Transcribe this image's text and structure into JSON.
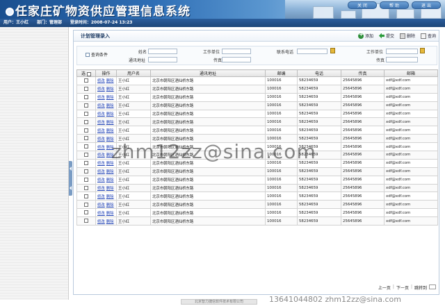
{
  "app": {
    "title": "任家庄矿物资供应管理信息系统"
  },
  "top_buttons": [
    "关 闭",
    "帮 助",
    "退 出"
  ],
  "userbar": {
    "user": "用户：王小红",
    "dept": "部门：管理部",
    "login": "登录时间：2008-07-24 13:23"
  },
  "panel": {
    "title": "计划管理录入",
    "toolbar": {
      "add": "添加",
      "submit": "提交",
      "delete": "删除",
      "query": "查询"
    }
  },
  "query": {
    "condition": "查询条件",
    "name": "姓名",
    "work_unit": "工作单位",
    "phone": "联系电话",
    "work_unit2": "工作单位",
    "address": "通讯地址",
    "fax": "传真",
    "fax2": "传真"
  },
  "table": {
    "headers": [
      "选",
      "操作",
      "用户名",
      "通讯地址",
      "邮编",
      "电话",
      "传真",
      "邮箱"
    ],
    "edit": "修改",
    "del": "删除",
    "row": {
      "name": "王小红",
      "address": "北京市朝阳区酒仙桥东路",
      "zip": "100016",
      "phone": "58234659",
      "fax": "25645896",
      "email": "xdf@xdf.com"
    },
    "row_count": 18
  },
  "pager": {
    "prev": "上一页",
    "next": "下一页",
    "jump": "跳转到"
  },
  "footer": "北京智力捷信软件技术有限公司",
  "watermark": "zhm12zz@sina.com",
  "bottom_mark": "13641044802    zhm12zz@sina.com"
}
